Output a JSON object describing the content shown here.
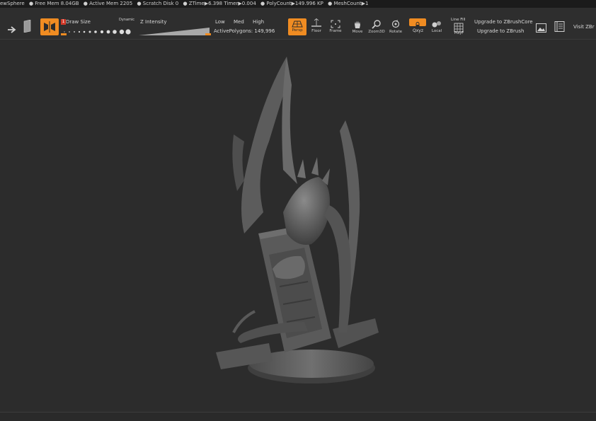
{
  "status": {
    "items": [
      "ewSphere",
      "● Free Mem 8.04GB",
      "● Active Mem 2205",
      "● Scratch Disk 0",
      "● ZTime▶6.398 Timer▶0.004",
      "● PolyCount▶149.996 KP",
      "● MeshCount▶1"
    ]
  },
  "toolbar": {
    "draw_size_label": "Draw Size",
    "draw_size_badge": "1",
    "dynamic_label": "Dynamic",
    "z_intensity_label": "Z Intensity",
    "low": "Low",
    "med": "Med",
    "high": "High",
    "active_polygons": "ActivePolygons: 149,996",
    "persp": "Persp",
    "floor": "Floor",
    "frame": "Frame",
    "move": "Move",
    "zoom3d": "Zoom3D",
    "rotate": "Rotate",
    "xyz": "Qxyz",
    "local": "Local",
    "line_fill": "Line Fill",
    "polyf": "PolyF",
    "upgrade_core": "Upgrade to ZBrushCore",
    "upgrade_zbrush": "Upgrade to ZBrush",
    "visit": "Visit ZBr"
  },
  "colors": {
    "accent": "#f08c22",
    "bg": "#2c2c2c",
    "toolbar": "#2e2e2e",
    "status": "#1b1b1b"
  }
}
